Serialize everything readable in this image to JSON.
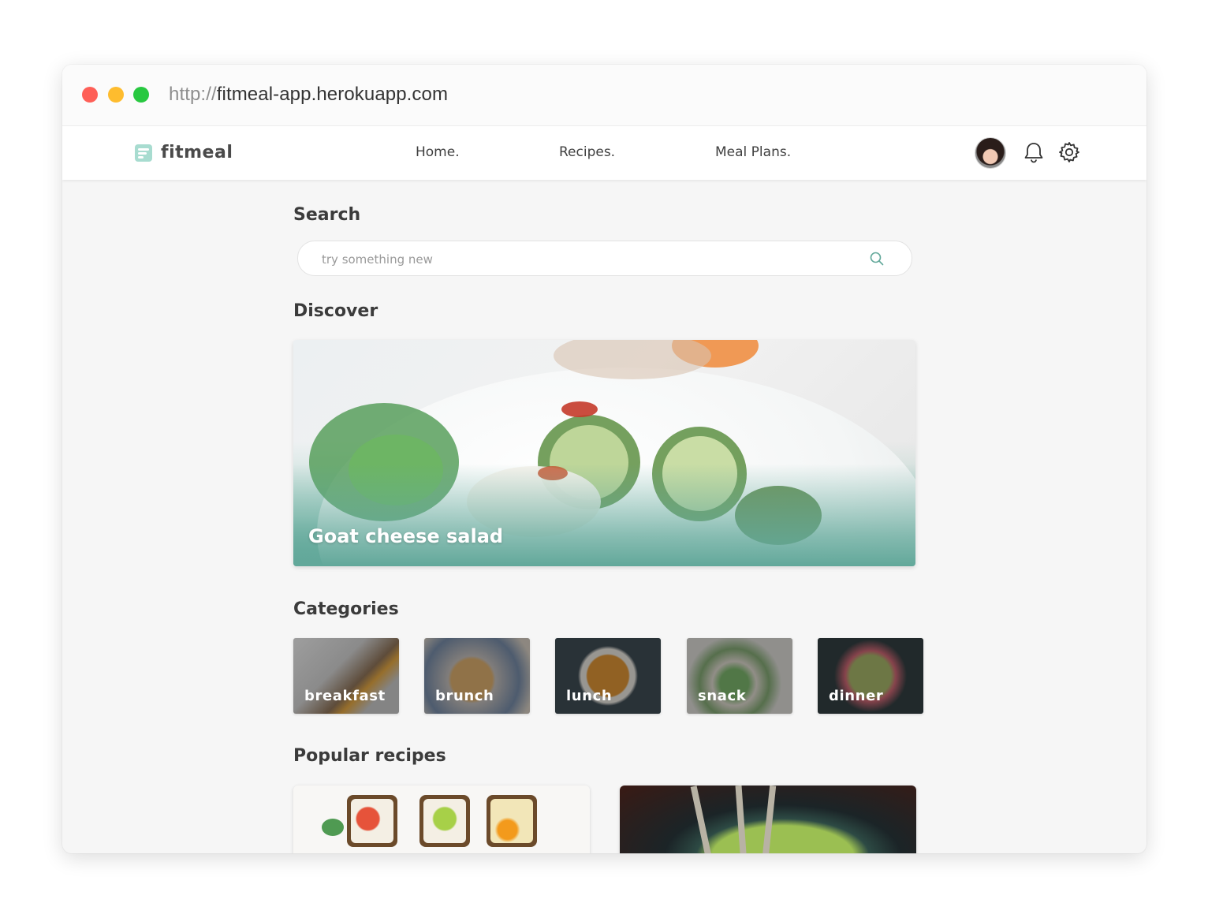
{
  "browser": {
    "url_protocol": "http://",
    "url_host": "fitmeal-app.herokuapp.com"
  },
  "navbar": {
    "brand": "fitmeal",
    "links": [
      "Home.",
      "Recipes.",
      "Meal Plans."
    ]
  },
  "search": {
    "heading": "Search",
    "placeholder": "try something new"
  },
  "discover": {
    "heading": "Discover",
    "feature_title": "Goat cheese salad"
  },
  "categories": {
    "heading": "Categories",
    "items": [
      "breakfast",
      "brunch",
      "lunch",
      "snack",
      "dinner"
    ]
  },
  "popular": {
    "heading": "Popular recipes"
  },
  "colors": {
    "accent": "#62a89a",
    "logo_mint": "#a8dcd0",
    "text_dark": "#3b3b3b"
  },
  "icons": [
    "search-icon",
    "bell-icon",
    "gear-icon",
    "logo-icon"
  ]
}
